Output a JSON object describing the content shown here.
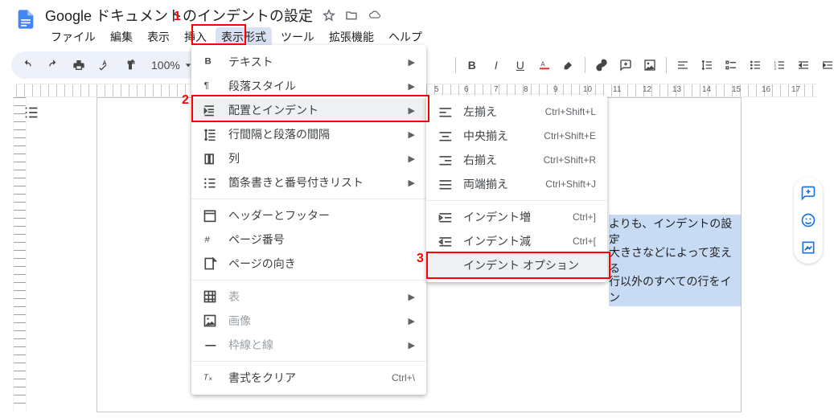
{
  "doc": {
    "title": "Google ドキュメントのインデントの設定"
  },
  "menubar": [
    "ファイル",
    "編集",
    "表示",
    "挿入",
    "表示形式",
    "ツール",
    "拡張機能",
    "ヘルプ"
  ],
  "menubar_active_index": 4,
  "toolbar": {
    "zoom": "100%"
  },
  "ruler_numbers": [
    "5",
    "6",
    "7",
    "8",
    "9",
    "10",
    "11",
    "12",
    "13",
    "14",
    "15",
    "16",
    "17"
  ],
  "menu1": [
    {
      "icon": "B",
      "label": "テキスト",
      "arrow": true
    },
    {
      "icon": "¶",
      "label": "段落スタイル",
      "arrow": true
    },
    {
      "icon": "indent",
      "label": "配置とインデント",
      "arrow": true,
      "selected": true
    },
    {
      "icon": "spacing",
      "label": "行間隔と段落の間隔",
      "arrow": true
    },
    {
      "icon": "columns",
      "label": "列",
      "arrow": true
    },
    {
      "icon": "bullets",
      "label": "箇条書きと番号付きリスト",
      "arrow": true
    },
    {
      "divider": true
    },
    {
      "icon": "header",
      "label": "ヘッダーとフッター"
    },
    {
      "icon": "#",
      "label": "ページ番号"
    },
    {
      "icon": "orient",
      "label": "ページの向き"
    },
    {
      "divider": true
    },
    {
      "icon": "table",
      "label": "表",
      "arrow": true,
      "disabled": true
    },
    {
      "icon": "image",
      "label": "画像",
      "arrow": true,
      "disabled": true
    },
    {
      "icon": "border",
      "label": "枠線と線",
      "arrow": true,
      "disabled": true
    },
    {
      "divider": true
    },
    {
      "icon": "clear",
      "label": "書式をクリア",
      "shortcut": "Ctrl+\\"
    }
  ],
  "menu2": [
    {
      "icon": "align-l",
      "label": "左揃え",
      "shortcut": "Ctrl+Shift+L"
    },
    {
      "icon": "align-c",
      "label": "中央揃え",
      "shortcut": "Ctrl+Shift+E"
    },
    {
      "icon": "align-r",
      "label": "右揃え",
      "shortcut": "Ctrl+Shift+R"
    },
    {
      "icon": "align-j",
      "label": "両端揃え",
      "shortcut": "Ctrl+Shift+J"
    },
    {
      "divider": true
    },
    {
      "icon": "ind-inc",
      "label": "インデント増",
      "shortcut": "Ctrl+]"
    },
    {
      "icon": "ind-dec",
      "label": "インデント減",
      "shortcut": "Ctrl+["
    },
    {
      "icon": "",
      "label": "インデント オプション",
      "selected": true
    }
  ],
  "annotations": {
    "a1": "1",
    "a2": "2",
    "a3": "3"
  },
  "doc_text": {
    "t1": "よりも、インデントの設定",
    "t2": "大きさなどによって変える",
    "t3": "行以外のすべての行をイン"
  }
}
